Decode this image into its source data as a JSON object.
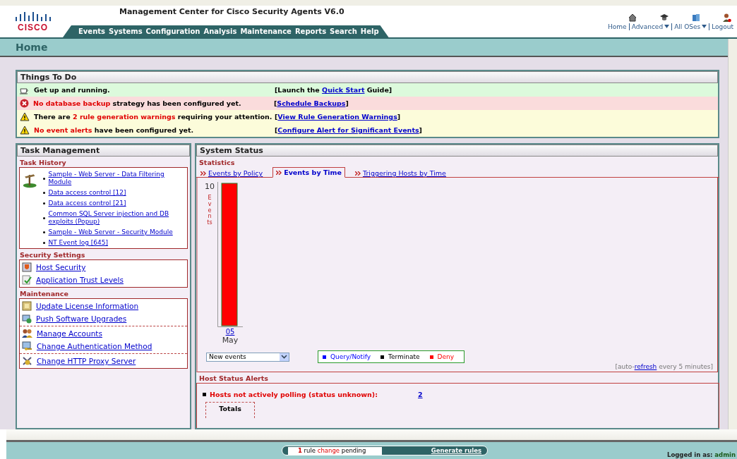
{
  "header": {
    "title": "Management Center for Cisco Security Agents V6.0",
    "logo": "CISCO",
    "menu": [
      "Events",
      "Systems",
      "Configuration",
      "Analysis",
      "Maintenance",
      "Reports",
      "Search",
      "Help"
    ],
    "links": [
      {
        "label": "Home",
        "dropdown": false
      },
      {
        "label": "Advanced",
        "dropdown": true
      },
      {
        "label": "All OSes",
        "dropdown": true
      },
      {
        "label": "Logout",
        "dropdown": false
      }
    ]
  },
  "page_title": "Home",
  "things_to_do": {
    "title": "Things To Do",
    "rows": [
      {
        "kind": "info",
        "parts": [
          {
            "text": "Get up and running.",
            "alert": false
          }
        ],
        "action": [
          {
            "text": "[Launch the ",
            "link": false
          },
          {
            "text": "Quick Start",
            "link": true
          },
          {
            "text": " Guide]",
            "link": false
          }
        ]
      },
      {
        "kind": "error",
        "parts": [
          {
            "text": "No database backup",
            "alert": true
          },
          {
            "text": " strategy has been configured yet.",
            "alert": false
          }
        ],
        "action": [
          {
            "text": "[",
            "link": false
          },
          {
            "text": "Schedule Backups",
            "link": true
          },
          {
            "text": "]",
            "link": false
          }
        ]
      },
      {
        "kind": "warning",
        "parts": [
          {
            "text": "There are ",
            "alert": false
          },
          {
            "text": "2 rule generation warnings",
            "alert": true
          },
          {
            "text": " requiring your attention.",
            "alert": false
          }
        ],
        "action": [
          {
            "text": "[",
            "link": false
          },
          {
            "text": "View Rule Generation Warnings",
            "link": true
          },
          {
            "text": "]",
            "link": false
          }
        ]
      },
      {
        "kind": "warning",
        "parts": [
          {
            "text": "No event alerts",
            "alert": true
          },
          {
            "text": " have been configured yet.",
            "alert": false
          }
        ],
        "action": [
          {
            "text": "[",
            "link": false
          },
          {
            "text": "Configure Alert for Significant Events",
            "link": true
          },
          {
            "text": "]",
            "link": false
          }
        ]
      }
    ]
  },
  "task_management": {
    "title": "Task Management",
    "task_history": {
      "title": "Task History",
      "items": [
        "Sample - Web Server - Data Filtering Module",
        "Data access control [12]",
        "Data access control [21]",
        "Common SQL Server injection and DB exploits (Popup)",
        "Sample - Web Server - Security Module",
        "NT Event log [645]"
      ]
    },
    "sections": [
      {
        "title": "Security Settings",
        "groups": [
          [
            {
              "label": "Host Security",
              "kind": "shield"
            },
            {
              "label": "Application Trust Levels",
              "kind": "check"
            }
          ]
        ]
      },
      {
        "title": "Maintenance",
        "groups": [
          [
            {
              "label": "Update License Information",
              "kind": "license"
            },
            {
              "label": "Push Software Upgrades",
              "kind": "upgrade"
            }
          ],
          [
            {
              "label": "Manage Accounts",
              "kind": "users"
            },
            {
              "label": "Change Authentication Method",
              "kind": "key"
            }
          ],
          [
            {
              "label": "Change HTTP Proxy Server",
              "kind": "proxy"
            }
          ]
        ]
      }
    ]
  },
  "system_status": {
    "title": "System Status",
    "statistics_title": "Statistics",
    "tabs": [
      {
        "label": "Events by Policy",
        "selected": false
      },
      {
        "label": "Events by Time",
        "selected": true
      },
      {
        "label": "Triggering Hosts by Time",
        "selected": false
      }
    ],
    "graph": {
      "top_value": "10",
      "axis_label": "Events",
      "category": "05",
      "month": "May"
    },
    "filter": "New events",
    "legend": [
      {
        "label": "Query/Notify",
        "color": "#0000ff"
      },
      {
        "label": "Terminate",
        "color": "#000000"
      },
      {
        "label": "Deny",
        "color": "#ff0000"
      }
    ],
    "refresh": {
      "before": "[auto-",
      "link": "refresh",
      "after": " every 5 minutes]"
    },
    "host_alerts": {
      "title": "Host Status Alerts",
      "label": "Hosts not actively polling (status unknown):",
      "value": "2",
      "totals": "Totals"
    }
  },
  "footer": {
    "pending": [
      {
        "text": "1",
        "kind": "count"
      },
      {
        "text": " rule ",
        "kind": "plain"
      },
      {
        "text": "change",
        "kind": "alert"
      },
      {
        "text": " pending",
        "kind": "plain"
      }
    ],
    "generate": "Generate rules",
    "logged_in_label": "Logged in as:",
    "user": "admin"
  }
}
